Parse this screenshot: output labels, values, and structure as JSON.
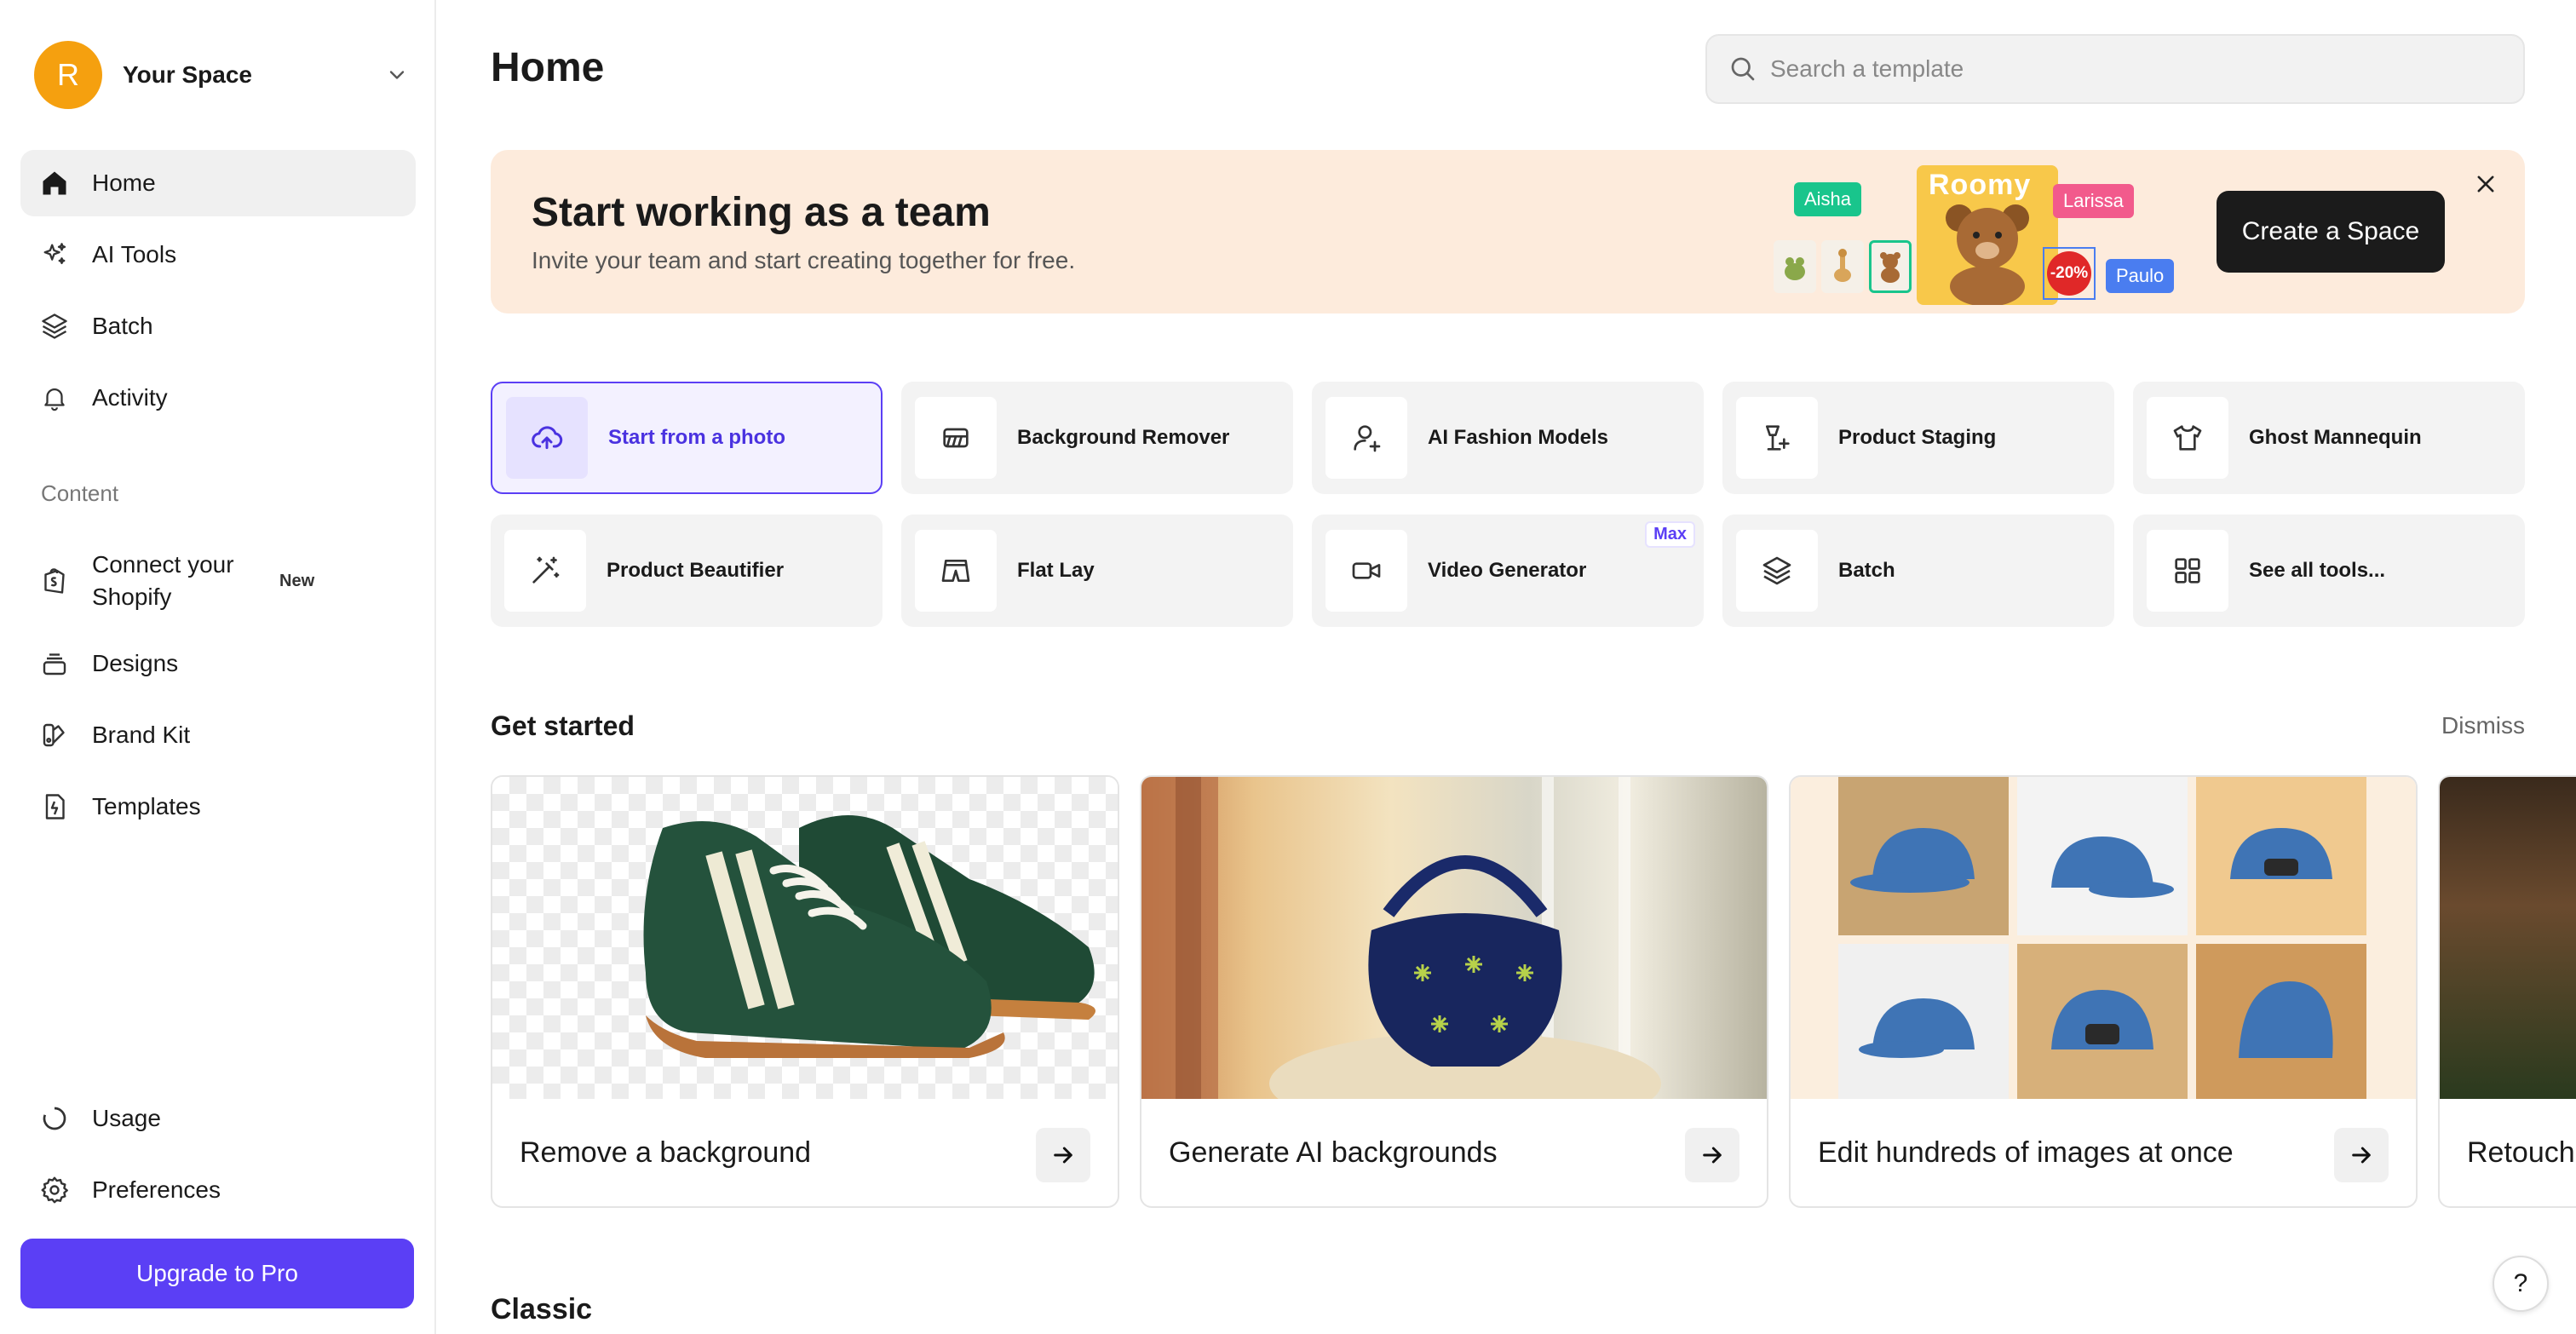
{
  "sidebar": {
    "space": {
      "avatar_letter": "R",
      "name": "Your Space"
    },
    "items": [
      {
        "label": "Home"
      },
      {
        "label": "AI Tools"
      },
      {
        "label": "Batch"
      },
      {
        "label": "Activity"
      }
    ],
    "content_heading": "Content",
    "content_items": [
      {
        "label": "Connect your Shopify",
        "badge": "New"
      },
      {
        "label": "Designs"
      },
      {
        "label": "Brand Kit"
      },
      {
        "label": "Templates"
      }
    ],
    "bottom_items": [
      {
        "label": "Usage"
      },
      {
        "label": "Preferences"
      }
    ],
    "upgrade_label": "Upgrade to Pro"
  },
  "header": {
    "title": "Home",
    "search_placeholder": "Search a template"
  },
  "banner": {
    "title": "Start working as a team",
    "subtitle": "Invite your team and start creating together for free.",
    "cta": "Create a Space",
    "tags": [
      "Aisha",
      "Larissa",
      "Paulo"
    ],
    "art_word": "Roomy",
    "discount": "-20%"
  },
  "tools": [
    {
      "label": "Start from a photo"
    },
    {
      "label": "Background Remover"
    },
    {
      "label": "AI Fashion Models"
    },
    {
      "label": "Product Staging"
    },
    {
      "label": "Ghost Mannequin"
    },
    {
      "label": "Product Beautifier"
    },
    {
      "label": "Flat Lay"
    },
    {
      "label": "Video Generator",
      "badge": "Max"
    },
    {
      "label": "Batch"
    },
    {
      "label": "See all tools..."
    }
  ],
  "get_started": {
    "title": "Get started",
    "dismiss": "Dismiss",
    "cards": [
      {
        "label": "Remove a background"
      },
      {
        "label": "Generate AI backgrounds"
      },
      {
        "label": "Edit hundreds of images at once"
      },
      {
        "label": "Retouch"
      }
    ]
  },
  "classic_heading": "Classic",
  "help_label": "?",
  "colors": {
    "accent": "#5b3ff5",
    "avatar": "#f5a00f",
    "banner_bg": "#fdebdc",
    "tag_aisha": "#19c58c",
    "tag_larissa": "#f25a8c",
    "tag_paulo": "#4a7df0"
  }
}
